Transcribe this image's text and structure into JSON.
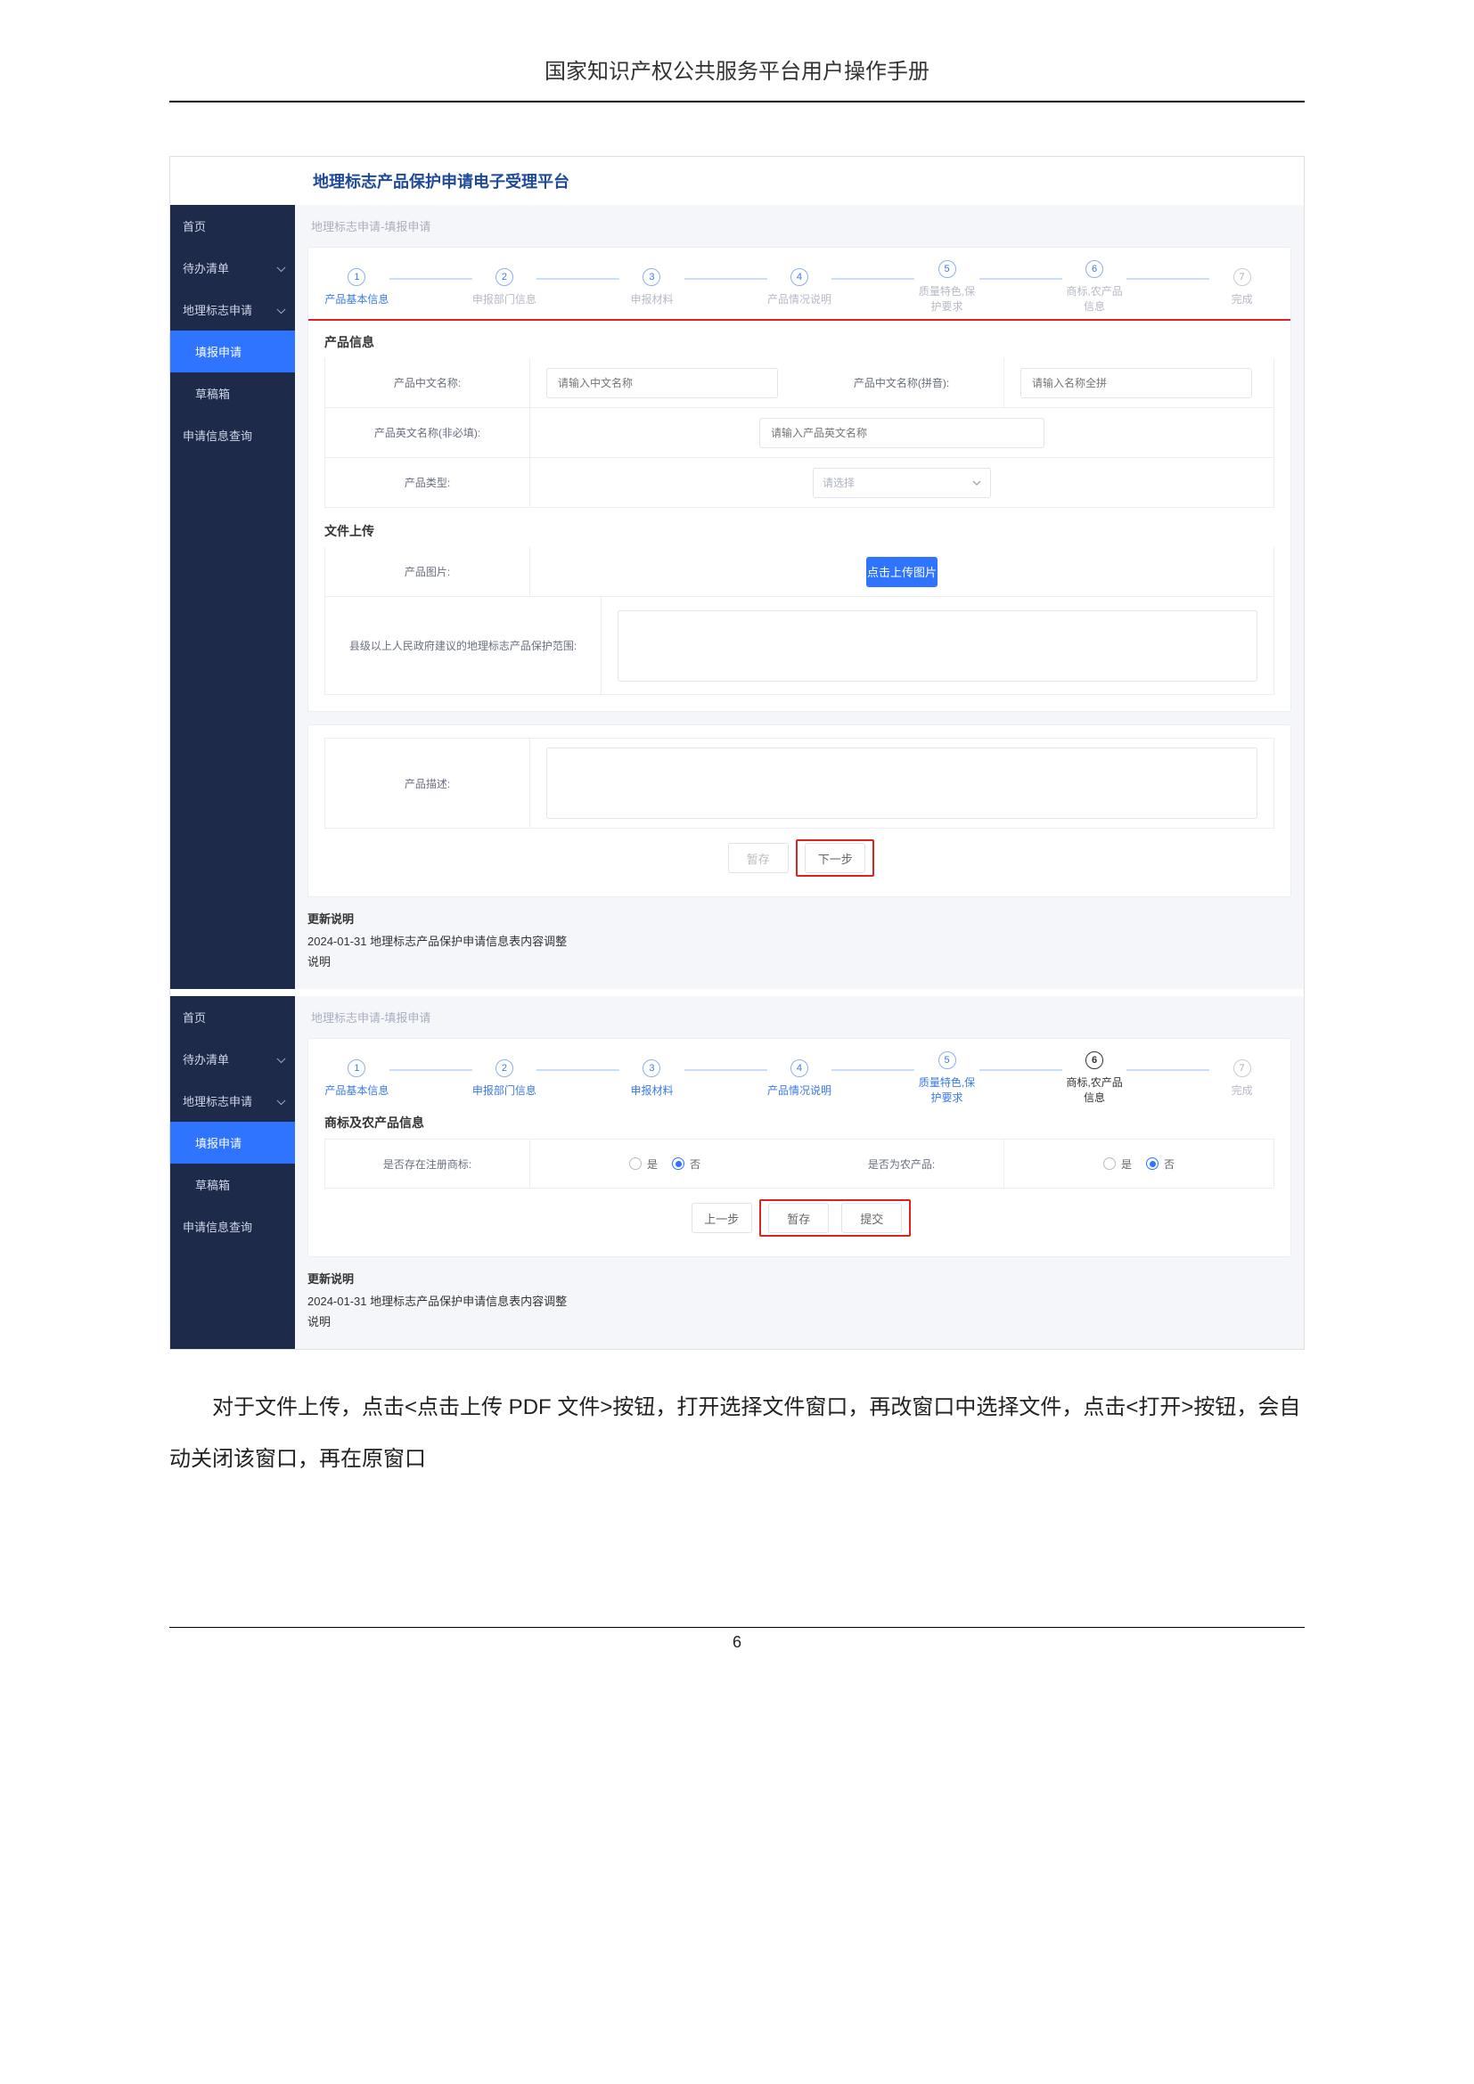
{
  "doc": {
    "header_title": "国家知识产权公共服务平台用户操作手册",
    "body_paragraph": "对于文件上传，点击<点击上传 PDF 文件>按钮，打开选择文件窗口，再改窗口中选择文件，点击<打开>按钮，会自动关闭该窗口，再在原窗口",
    "page_number": "6"
  },
  "app_header": {
    "title": "地理标志产品保护申请电子受理平台"
  },
  "sidebar": {
    "items": [
      {
        "label": "首页"
      },
      {
        "label": "待办清单"
      },
      {
        "label": "地理标志申请"
      },
      {
        "label": "填报申请"
      },
      {
        "label": "草稿箱"
      },
      {
        "label": "申请信息查询"
      }
    ]
  },
  "screen1": {
    "breadcrumb": "地理标志申请-填报申请",
    "steps": [
      "产品基本信息",
      "申报部门信息",
      "申报材料",
      "产品情况说明",
      "质量特色,保护要求",
      "商标,农产品信息",
      "完成"
    ],
    "active_step_index": 0,
    "section_product_info": "产品信息",
    "labels": {
      "name_cn": "产品中文名称:",
      "name_pinyin": "产品中文名称(拼音):",
      "name_en": "产品英文名称(非必填):",
      "type": "产品类型:"
    },
    "placeholders": {
      "name_cn": "请输入中文名称",
      "name_pinyin": "请输入名称全拼",
      "name_en": "请输入产品英文名称",
      "type": "请选择"
    },
    "section_upload": "文件上传",
    "upload": {
      "img_label": "产品图片:",
      "upload_btn": "点击上传图片",
      "scope_label": "县级以上人民政府建议的地理标志产品保护范围:"
    },
    "desc": {
      "label": "产品描述:"
    },
    "actions": {
      "save": "暂存",
      "next": "下一步"
    },
    "update_note": {
      "title": "更新说明",
      "line1": "2024-01-31 地理标志产品保护申请信息表内容调整",
      "line2": "说明"
    }
  },
  "screen2": {
    "breadcrumb": "地理标志申请-填报申请",
    "steps": [
      "产品基本信息",
      "申报部门信息",
      "申报材料",
      "产品情况说明",
      "质量特色,保护要求",
      "商标,农产品信息",
      "完成"
    ],
    "active_step_index": 5,
    "section": "商标及农产品信息",
    "q1_label": "是否存在注册商标:",
    "q2_label": "是否为农产品:",
    "yes": "是",
    "no": "否",
    "actions": {
      "prev": "上一步",
      "save": "暂存",
      "submit": "提交"
    },
    "update_note": {
      "title": "更新说明",
      "line1": "2024-01-31 地理标志产品保护申请信息表内容调整",
      "line2": "说明"
    }
  }
}
